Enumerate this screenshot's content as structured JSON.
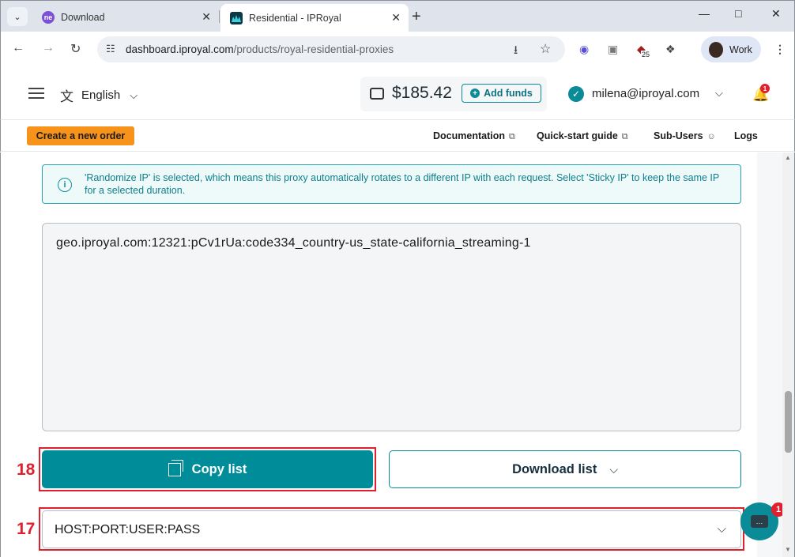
{
  "browser": {
    "tabs": [
      {
        "title": "Download",
        "favicon_text": "ne",
        "favicon_color": "#7b4fd6"
      },
      {
        "title": "Residential - IPRoyal",
        "favicon_color": "#0b3a46"
      }
    ],
    "url_host": "dashboard.iproyal.com",
    "url_path": "/products/royal-residential-proxies",
    "extension_badge": "25",
    "profile_label": "Work"
  },
  "header": {
    "language": "English",
    "balance": "$185.42",
    "add_funds_label": "Add funds",
    "email": "milena@iproyal.com",
    "notification_count": "1"
  },
  "subnav": {
    "create_order_label": "Create a new order",
    "links": [
      "Documentation",
      "Quick-start guide",
      "Sub-Users",
      "Logs"
    ]
  },
  "main": {
    "info_text": "'Randomize IP' is selected, which means this proxy automatically rotates to a different IP with each request. Select 'Sticky IP' to keep the same IP for a selected duration.",
    "proxy_list": "geo.iproyal.com:12321:pCv1rUa:code334_country-us_state-california_streaming-1",
    "copy_label": "Copy list",
    "download_label": "Download list",
    "format_value": "HOST:PORT:USER:PASS"
  },
  "annotations": {
    "copy_marker": "18",
    "format_marker": "17"
  },
  "chat": {
    "badge": "1"
  },
  "colors": {
    "accent": "#008c99",
    "order_button": "#f7931a",
    "annotation": "#e0202e"
  }
}
